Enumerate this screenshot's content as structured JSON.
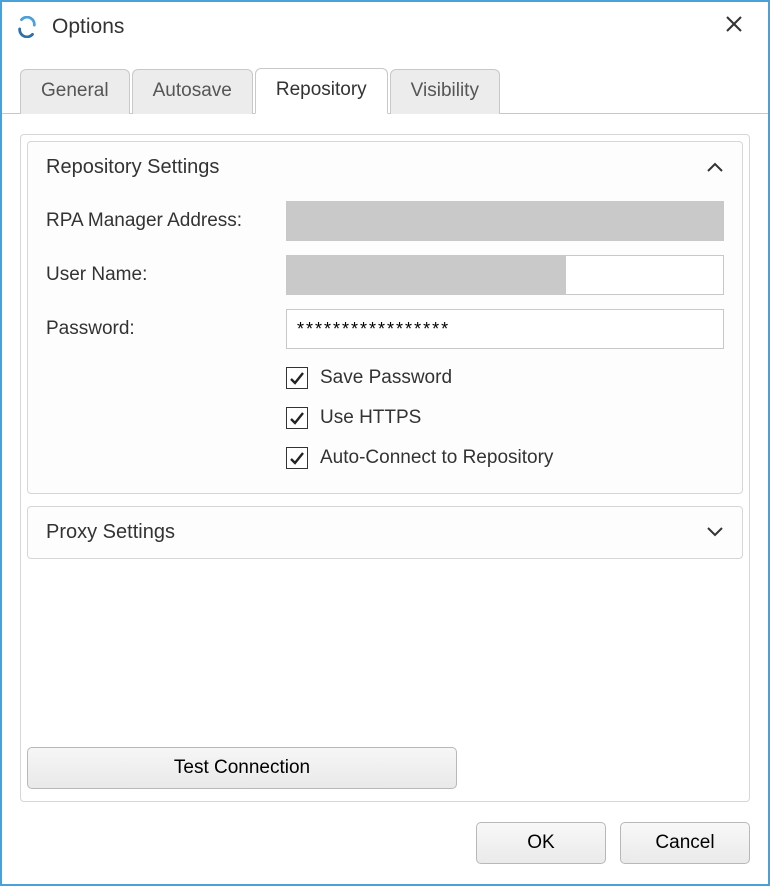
{
  "window": {
    "title": "Options"
  },
  "tabs": {
    "general": "General",
    "autosave": "Autosave",
    "repository": "Repository",
    "visibility": "Visibility",
    "active": "repository"
  },
  "repo": {
    "section_title": "Repository Settings",
    "address_label": "RPA Manager Address:",
    "address_value": "",
    "user_label": "User Name:",
    "user_value": "",
    "password_label": "Password:",
    "password_value": "*****************",
    "save_password_label": "Save Password",
    "save_password_checked": true,
    "use_https_label": "Use HTTPS",
    "use_https_checked": true,
    "autoconnect_label": "Auto-Connect to Repository",
    "autoconnect_checked": true
  },
  "proxy": {
    "section_title": "Proxy Settings",
    "expanded": false
  },
  "buttons": {
    "test": "Test Connection",
    "ok": "OK",
    "cancel": "Cancel"
  }
}
